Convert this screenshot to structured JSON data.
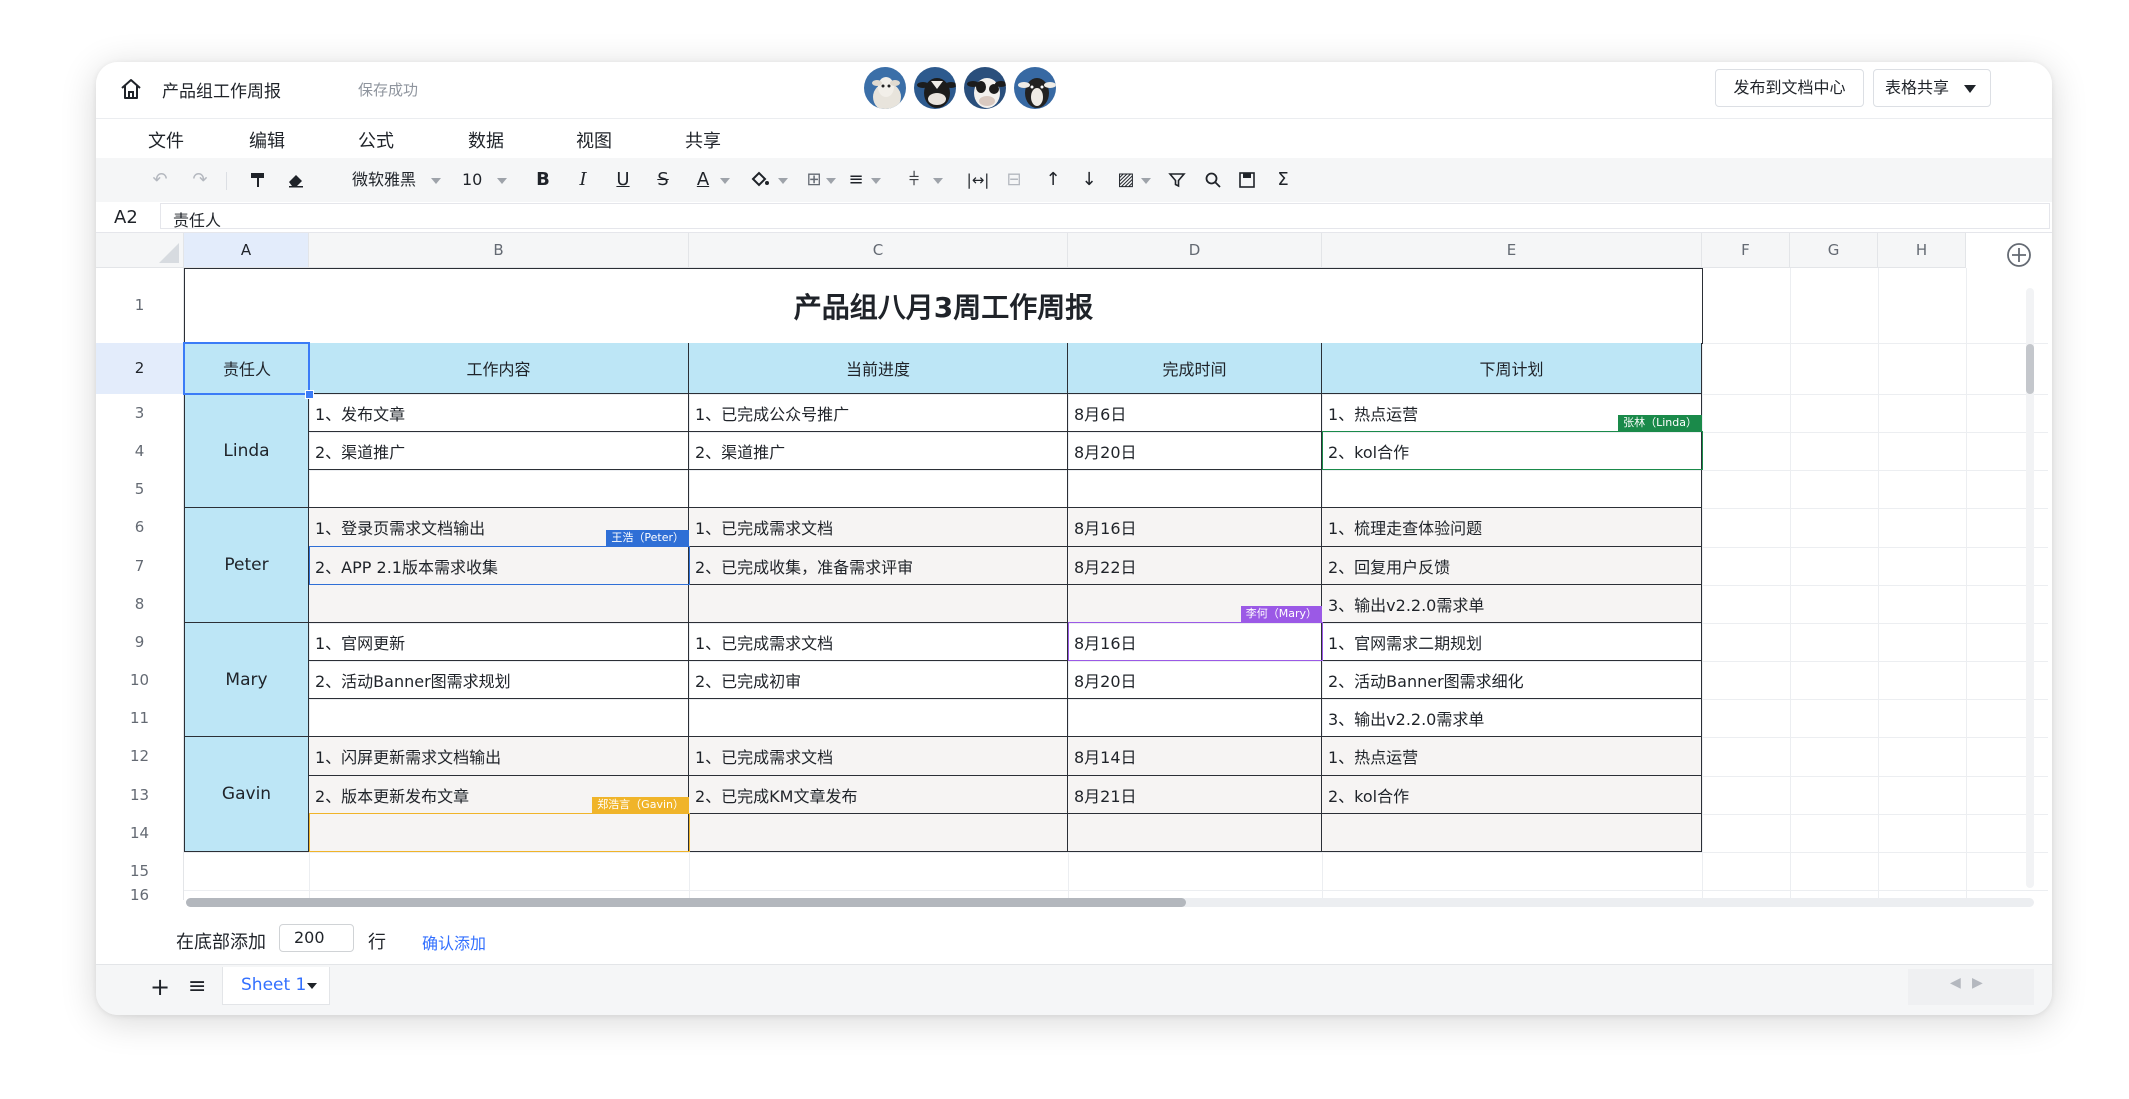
{
  "header": {
    "doc_title": "产品组工作周报",
    "save_status": "保存成功",
    "publish_label": "发布到文档中心",
    "share_label": "表格共享",
    "avatar_icons": [
      "sheep-avatar-icon",
      "cow-avatar-icon",
      "cow-avatar-icon",
      "goat-avatar-icon"
    ]
  },
  "menu": [
    "文件",
    "编辑",
    "公式",
    "数据",
    "视图",
    "共享"
  ],
  "toolbar": {
    "font_name": "微软雅黑",
    "font_size": "10",
    "bold": "B",
    "italic": "I",
    "underline": "U",
    "strike": "S",
    "font_color": "A",
    "sum": "Σ"
  },
  "formula_bar": {
    "cell_ref": "A2",
    "value": "责任人"
  },
  "columns": [
    "A",
    "B",
    "C",
    "D",
    "E",
    "F",
    "G",
    "H"
  ],
  "rows": [
    "1",
    "2",
    "3",
    "4",
    "5",
    "6",
    "7",
    "8",
    "9",
    "10",
    "11",
    "12",
    "13",
    "14",
    "15",
    "16"
  ],
  "sheet": {
    "title": "产品组八月3周工作周报",
    "headers": [
      "责任人",
      "工作内容",
      "当前进度",
      "完成时间",
      "下周计划"
    ],
    "owners": [
      "Linda",
      "Peter",
      "Mary",
      "Gavin"
    ],
    "work": [
      "1、发布文章",
      "2、渠道推广",
      "",
      "1、登录页需求文档输出",
      "2、APP 2.1版本需求收集",
      "",
      "1、官网更新",
      "2、活动Banner图需求规划",
      "",
      "1、闪屏更新需求文档输出",
      "2、版本更新发布文章",
      ""
    ],
    "progress": [
      "1、已完成公众号推广",
      "2、渠道推广",
      "",
      "1、已完成需求文档",
      "2、已完成收集，准备需求评审",
      "",
      "1、已完成需求文档",
      "2、已完成初审",
      "",
      "1、已完成需求文档",
      "2、已完成KM文章发布",
      ""
    ],
    "done_time": [
      "8月6日",
      "8月20日",
      "",
      "8月16日",
      "8月22日",
      "",
      "8月16日",
      "8月20日",
      "",
      "8月14日",
      "8月21日",
      ""
    ],
    "next_plan": [
      "1、热点运营",
      "2、kol合作",
      "",
      "1、梳理走查体验问题",
      "2、回复用户反馈",
      "3、输出v2.2.0需求单",
      "1、官网需求二期规划",
      "2、活动Banner图需求细化",
      "3、输出v2.2.0需求单",
      "1、热点运营",
      "2、kol合作",
      ""
    ]
  },
  "collaborators": [
    {
      "label": "张林（Linda）",
      "color": "#1a8a4a"
    },
    {
      "label": "王浩（Peter）",
      "color": "#2f6fd6"
    },
    {
      "label": "李何（Mary）",
      "color": "#9b59e6"
    },
    {
      "label": "郑浩言（Gavin）",
      "color": "#f0b429"
    }
  ],
  "add_rows": {
    "label_before": "在底部添加",
    "count": "200",
    "label_after": "行",
    "confirm": "确认添加"
  },
  "sheet_tabs": [
    {
      "name": "Sheet 1"
    }
  ],
  "colors": {
    "header_fill": "#bde6f6",
    "grey_fill": "#f6f4f3",
    "accent": "#3370ff"
  }
}
